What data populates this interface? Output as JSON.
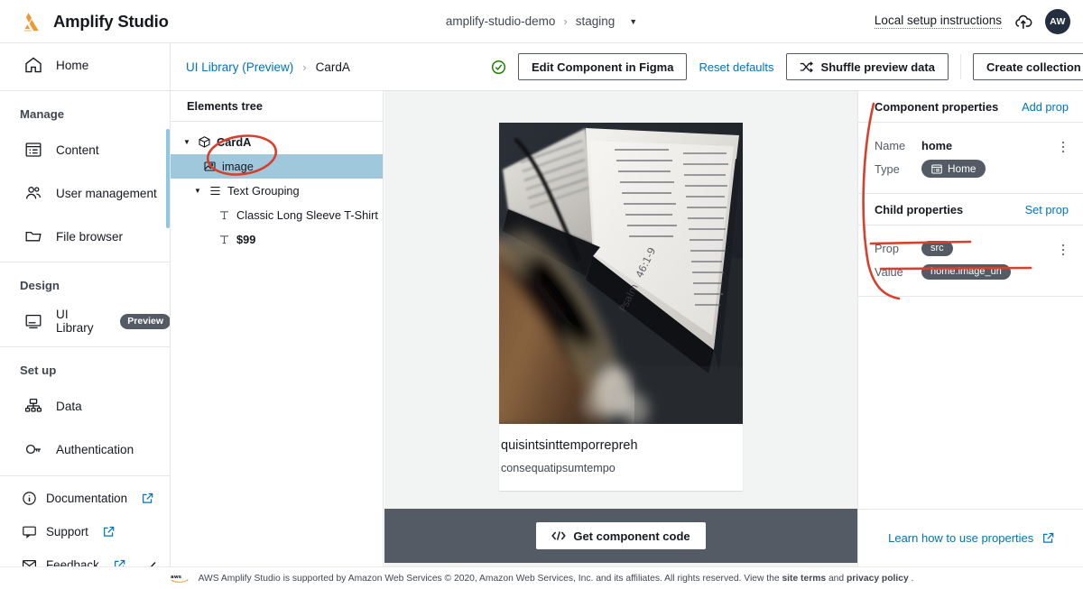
{
  "topbar": {
    "brand": "Amplify Studio",
    "logo_color": "#eb9b34",
    "app_name": "amplify-studio-demo",
    "env_name": "staging",
    "env_separator": "›",
    "env_caret": "▼",
    "local_setup": "Local setup instructions",
    "cloud_icon": "cloud-upload-icon",
    "avatar_initials": "AW",
    "avatar_color": "#232f3e"
  },
  "sidebar": {
    "home": {
      "label": "Home",
      "icon": "home-icon"
    },
    "groups": [
      {
        "title": "Manage",
        "items": [
          {
            "label": "Content",
            "icon": "content-icon"
          },
          {
            "label": "User management",
            "icon": "users-icon"
          },
          {
            "label": "File browser",
            "icon": "folder-icon"
          }
        ]
      },
      {
        "title": "Design",
        "items": [
          {
            "label": "UI Library",
            "icon": "monitor-icon",
            "badge": "Preview"
          }
        ]
      },
      {
        "title": "Set up",
        "items": [
          {
            "label": "Data",
            "icon": "data-icon"
          },
          {
            "label": "Authentication",
            "icon": "auth-icon"
          }
        ]
      }
    ],
    "bottom_items": [
      {
        "label": "Documentation",
        "icon": "info-icon",
        "external": true
      },
      {
        "label": "Support",
        "icon": "support-icon",
        "external": true
      },
      {
        "label": "Feedback",
        "icon": "mail-icon",
        "external": true
      }
    ],
    "collapse_icon": "chevron-left-icon"
  },
  "subheader": {
    "breadcrumb_root": "UI Library (Preview)",
    "breadcrumb_sep": "›",
    "breadcrumb_current": "CardA",
    "status_icon": "check-circle-icon",
    "status_color": "#1d8102",
    "edit_figma_label": "Edit Component in Figma",
    "reset_defaults_label": "Reset defaults",
    "shuffle_icon": "shuffle-icon",
    "shuffle_label": "Shuffle preview data",
    "create_collection_label": "Create collection"
  },
  "tree": {
    "header": "Elements tree",
    "nodes": [
      {
        "label": "CardA",
        "icon": "cube-icon",
        "twisty": "▼",
        "depth": 1,
        "bold": true,
        "selected": false
      },
      {
        "label": "image",
        "icon": "image-icon",
        "twisty": "",
        "depth": 2,
        "bold": false,
        "selected": true
      },
      {
        "label": "Text Grouping",
        "icon": "group-icon",
        "twisty": "▼",
        "depth": 2,
        "bold": false,
        "selected": false
      },
      {
        "label": "Classic Long Sleeve T-Shirt",
        "icon": "text-icon",
        "twisty": "",
        "depth": 3,
        "bold": false,
        "selected": false
      },
      {
        "label": "$99",
        "icon": "text-icon",
        "twisty": "",
        "depth": 3,
        "bold": false,
        "selected": false
      }
    ]
  },
  "preview": {
    "image_alt": "open-book-with-guitar-photo",
    "card_title": "quisintsinttemporrepreh",
    "card_subtitle": "consequatipsumtempo",
    "get_code_icon": "code-icon",
    "get_code_label": "Get component code",
    "canvas_bg": "#f2f3f3",
    "codebar_bg": "#545b64"
  },
  "properties": {
    "component_section_title": "Component properties",
    "add_prop_label": "Add prop",
    "name_label": "Name",
    "name_value": "home",
    "type_label": "Type",
    "type_chip": "Home",
    "type_chip_icon": "model-icon",
    "child_section_title": "Child properties",
    "set_prop_label": "Set prop",
    "prop_label": "Prop",
    "prop_chip": "src",
    "value_label": "Value",
    "value_chip": "home.image_url",
    "kebab_icon": "more-options-icon",
    "learn_more_label": "Learn how to use properties",
    "chip_color": "#545b64",
    "link_color": "#0073bb"
  },
  "annotations": {
    "color": "#d6402c",
    "shapes": [
      "ellipse-around-image-node",
      "curve-beside-properties-panel",
      "underline-prop-row",
      "underline-value-row"
    ]
  },
  "footer": {
    "aws_mark": "aws-logo",
    "text_before": "AWS Amplify Studio is supported by Amazon Web Services © 2020, Amazon Web Services, Inc. and its affiliates. All rights reserved. View the ",
    "link_site_terms": "site terms",
    "text_and": " and ",
    "link_privacy": "privacy policy",
    "text_after": " ."
  }
}
